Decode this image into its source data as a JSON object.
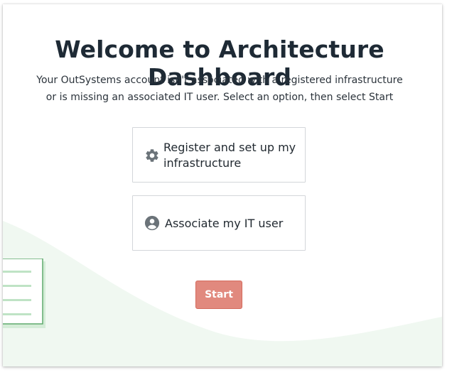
{
  "dashboard": {
    "title": "Welcome to Architecture Dashboard",
    "subtitle_line1": "Your OutSystems account isn't associated with a registered infrastructure",
    "subtitle_line2": "or is missing an associated IT user. Select an option, then select Start"
  },
  "options": [
    {
      "label": "Register and set up my infrastructure",
      "icon": "gear-icon",
      "selected": false
    },
    {
      "label": "Associate my IT user",
      "icon": "user-circle-icon",
      "selected": false
    }
  ],
  "start_button": {
    "label": "Start",
    "enabled": false
  },
  "colors": {
    "title": "#1e2a35",
    "start_button_bg": "#e1897e",
    "option_border": "#d3d6da",
    "wave_fill": "#eef7ef",
    "illustration_green": "#7dc48a",
    "icon_gray": "#6b7379"
  }
}
